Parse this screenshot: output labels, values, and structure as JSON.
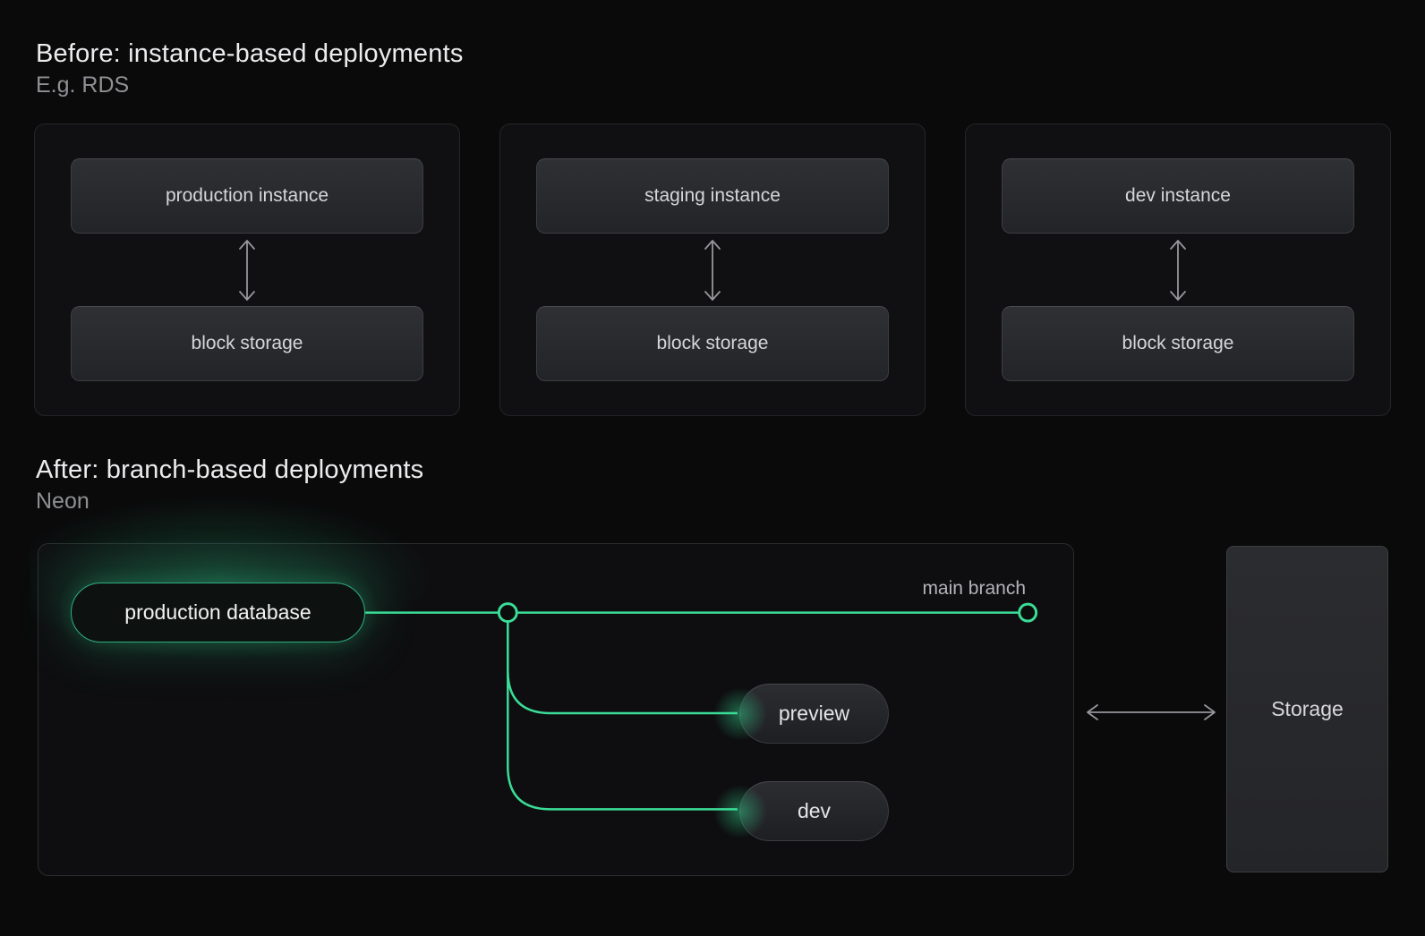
{
  "colors": {
    "accent_green": "#3bdc97",
    "arrow_gray": "#96969b"
  },
  "before": {
    "title": "Before: instance-based deployments",
    "subtitle": "E.g. RDS",
    "cards": [
      {
        "instance": "production instance",
        "storage": "block storage"
      },
      {
        "instance": "staging instance",
        "storage": "block storage"
      },
      {
        "instance": "dev instance",
        "storage": "block storage"
      }
    ]
  },
  "after": {
    "title": "After: branch-based deployments",
    "subtitle": "Neon",
    "production_pill": "production database",
    "main_branch_label": "main branch",
    "branches": [
      {
        "label": "preview"
      },
      {
        "label": "dev"
      }
    ],
    "storage_label": "Storage"
  }
}
